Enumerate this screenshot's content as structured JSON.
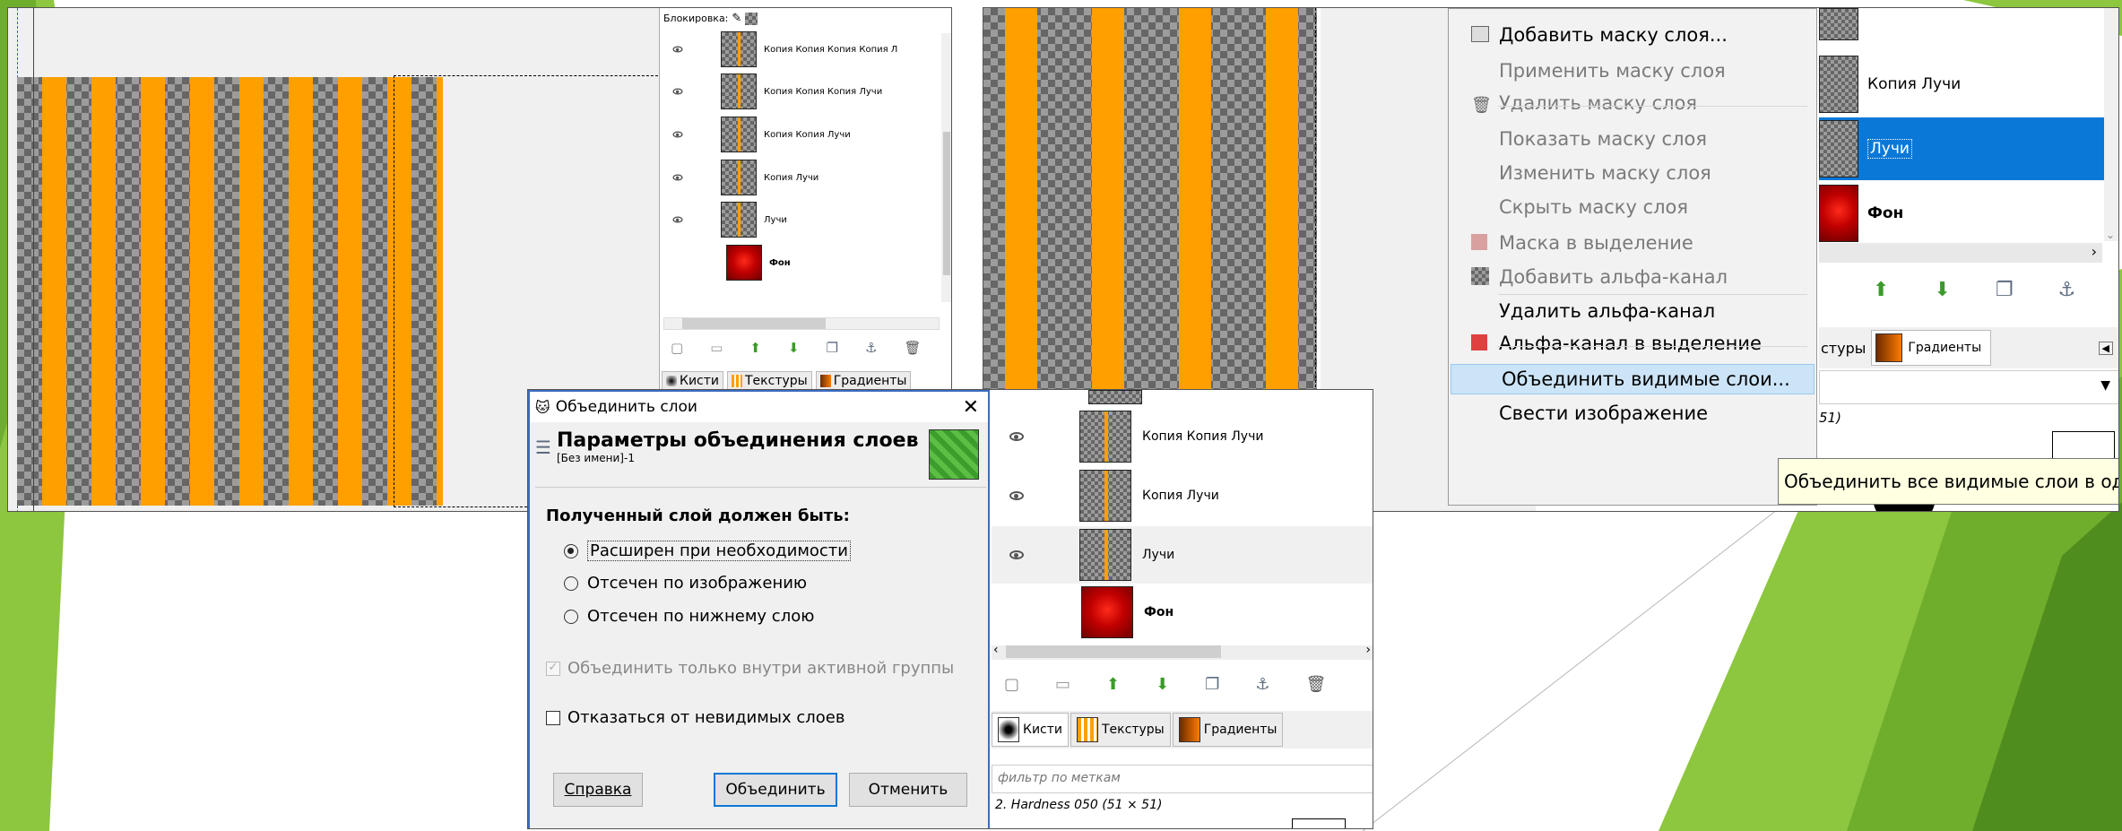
{
  "colors": {
    "green_primary": "#8dc63f",
    "stripe_orange": "#ff9f00",
    "selection_blue": "#0a78d7",
    "tooltip_bg": "#ffffe1",
    "red_fon": "#c00000"
  },
  "panel1": {
    "lock_label": "Блокировка:",
    "layers": [
      {
        "name": "Копия Копия Копия Копия Л"
      },
      {
        "name": "Копия Копия Копия Лучи"
      },
      {
        "name": "Копия Копия Лучи"
      },
      {
        "name": "Копия Лучи"
      },
      {
        "name": "Лучи"
      },
      {
        "name": "Фон"
      }
    ],
    "tabs": [
      "Кисти",
      "Текстуры",
      "Градиенты"
    ]
  },
  "dialog": {
    "title": "Объединить слои",
    "heading": "Параметры объединения слоев",
    "subheading": "[Без имени]-1",
    "group_label": "Полученный слой должен быть:",
    "options": [
      {
        "label": "Расширен при необходимости",
        "selected": true
      },
      {
        "label": "Отсечен по изображению",
        "selected": false
      },
      {
        "label": "Отсечен по нижнему слою",
        "selected": false
      }
    ],
    "check_active_group": "Объединить только внутри активной группы",
    "check_discard": "Отказаться от невидимых слоев",
    "buttons": {
      "help": "Справка",
      "merge": "Объединить",
      "cancel": "Отменить"
    }
  },
  "layers2": {
    "rows": [
      {
        "name": "Копия Копия Лучи"
      },
      {
        "name": "Копия Лучи"
      },
      {
        "name": "Лучи"
      },
      {
        "name": "Фон"
      }
    ],
    "tabs": [
      "Кисти",
      "Текстуры",
      "Градиенты"
    ],
    "filter_placeholder": "фильтр по меткам",
    "brush_info": "2. Hardness 050 (51 × 51)"
  },
  "menu": {
    "items": [
      {
        "label": "Добавить маску слоя...",
        "enabled": true,
        "icon": "mask-add-icon"
      },
      {
        "label": "Применить маску слоя",
        "enabled": false,
        "icon": ""
      },
      {
        "label": "Удалить маску слоя",
        "enabled": false,
        "icon": "trash-icon"
      },
      {
        "label": "Показать маску слоя",
        "enabled": false,
        "icon": ""
      },
      {
        "label": "Изменить маску слоя",
        "enabled": false,
        "icon": ""
      },
      {
        "label": "Скрыть маску слоя",
        "enabled": false,
        "icon": ""
      },
      {
        "label": "Маска в выделение",
        "enabled": false,
        "icon": "mask-selection-icon"
      },
      {
        "label": "Добавить альфа-канал",
        "enabled": false,
        "icon": "alpha-add-icon"
      },
      {
        "label": "Удалить альфа-канал",
        "enabled": true,
        "icon": ""
      },
      {
        "label": "Альфа-канал в выделение",
        "enabled": true,
        "icon": "alpha-selection-icon"
      },
      {
        "label": "Объединить видимые слои...",
        "enabled": true,
        "highlighted": true,
        "icon": ""
      },
      {
        "label": "Свести изображение",
        "enabled": true,
        "icon": ""
      }
    ],
    "tooltip": "Объединить все видимые слои в оди"
  },
  "layers3": {
    "rows": [
      {
        "name": "Копия Лучи"
      },
      {
        "name": "Лучи"
      },
      {
        "name": "Фон"
      }
    ],
    "tabs": [
      "стуры",
      "Градиенты"
    ],
    "brush_size": "51)"
  }
}
